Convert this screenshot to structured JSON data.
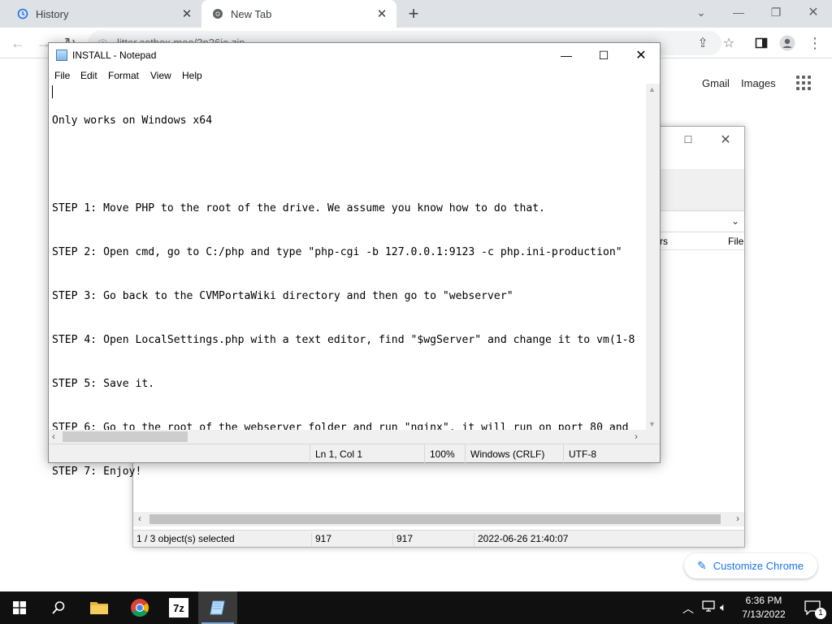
{
  "chrome": {
    "tabs": [
      {
        "title": "History",
        "icon": "history-icon"
      },
      {
        "title": "New Tab",
        "icon": "chrome-icon"
      }
    ],
    "omnibox_text": "litter.catbox.moe/3n26io.zip",
    "ntp": {
      "gmail": "Gmail",
      "images": "Images",
      "customize": "Customize Chrome"
    }
  },
  "zip": {
    "columns": {
      "partial": "rs",
      "file": "File"
    },
    "status": {
      "selected": "1 / 3 object(s) selected",
      "size": "917",
      "packed": "917",
      "modified": "2022-06-26 21:40:07"
    }
  },
  "notepad": {
    "title": "INSTALL - Notepad",
    "menu": [
      "File",
      "Edit",
      "Format",
      "View",
      "Help"
    ],
    "lines": [
      "Only works on Windows x64",
      "",
      "STEP 1: Move PHP to the root of the drive. We assume you know how to do that.",
      "STEP 2: Open cmd, go to C:/php and type \"php-cgi -b 127.0.0.1:9123 -c php.ini-production\"",
      "STEP 3: Go back to the CVMPortaWiki directory and then go to \"webserver\"",
      "STEP 4: Open LocalSettings.php with a text editor, find \"$wgServer\" and change it to vm(1-8",
      "STEP 5: Save it.",
      "STEP 6: Go to the root of the webserver folder and run \"nginx\", it will run on port 80 and",
      "STEP 7: Enjoy!"
    ],
    "status": {
      "position": "Ln 1, Col 1",
      "zoom": "100%",
      "line_ending": "Windows (CRLF)",
      "encoding": "UTF-8"
    }
  },
  "taskbar": {
    "apps": [
      "start-icon",
      "search-icon",
      "file-explorer-icon",
      "chrome-icon",
      "7zip-icon",
      "notepad-icon"
    ],
    "zip_label": "7z",
    "time": "6:36 PM",
    "date": "7/13/2022",
    "notifications": "1"
  }
}
